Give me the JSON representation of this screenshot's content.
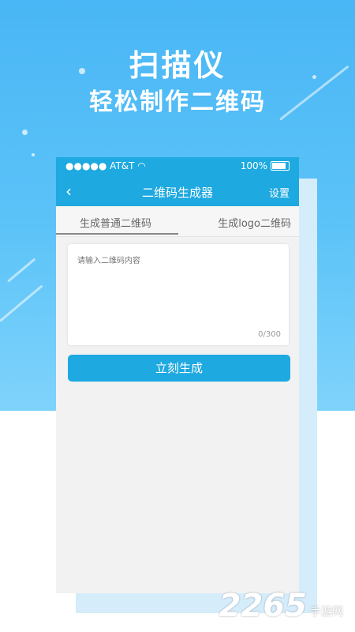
{
  "promo": {
    "title_line1": "扫描仪",
    "title_line2": "轻松制作二维码"
  },
  "status_bar": {
    "carrier": "●●●●● AT&T",
    "wifi_icon": "wifi-icon",
    "battery_text": "100%"
  },
  "nav": {
    "back_icon": "chevron-left-icon",
    "title": "二维码生成器",
    "settings_label": "设置"
  },
  "tabs": [
    {
      "label": "生成普通二维码",
      "active": true
    },
    {
      "label": "生成logo二维码",
      "active": false
    }
  ],
  "input": {
    "placeholder": "请输入二维码内容",
    "counter": "0/300"
  },
  "submit_label": "立刻生成",
  "watermark": {
    "number": "2265",
    "text": "手游网"
  },
  "colors": {
    "accent": "#1ea9e0",
    "hero_background": "#49b6f5"
  }
}
